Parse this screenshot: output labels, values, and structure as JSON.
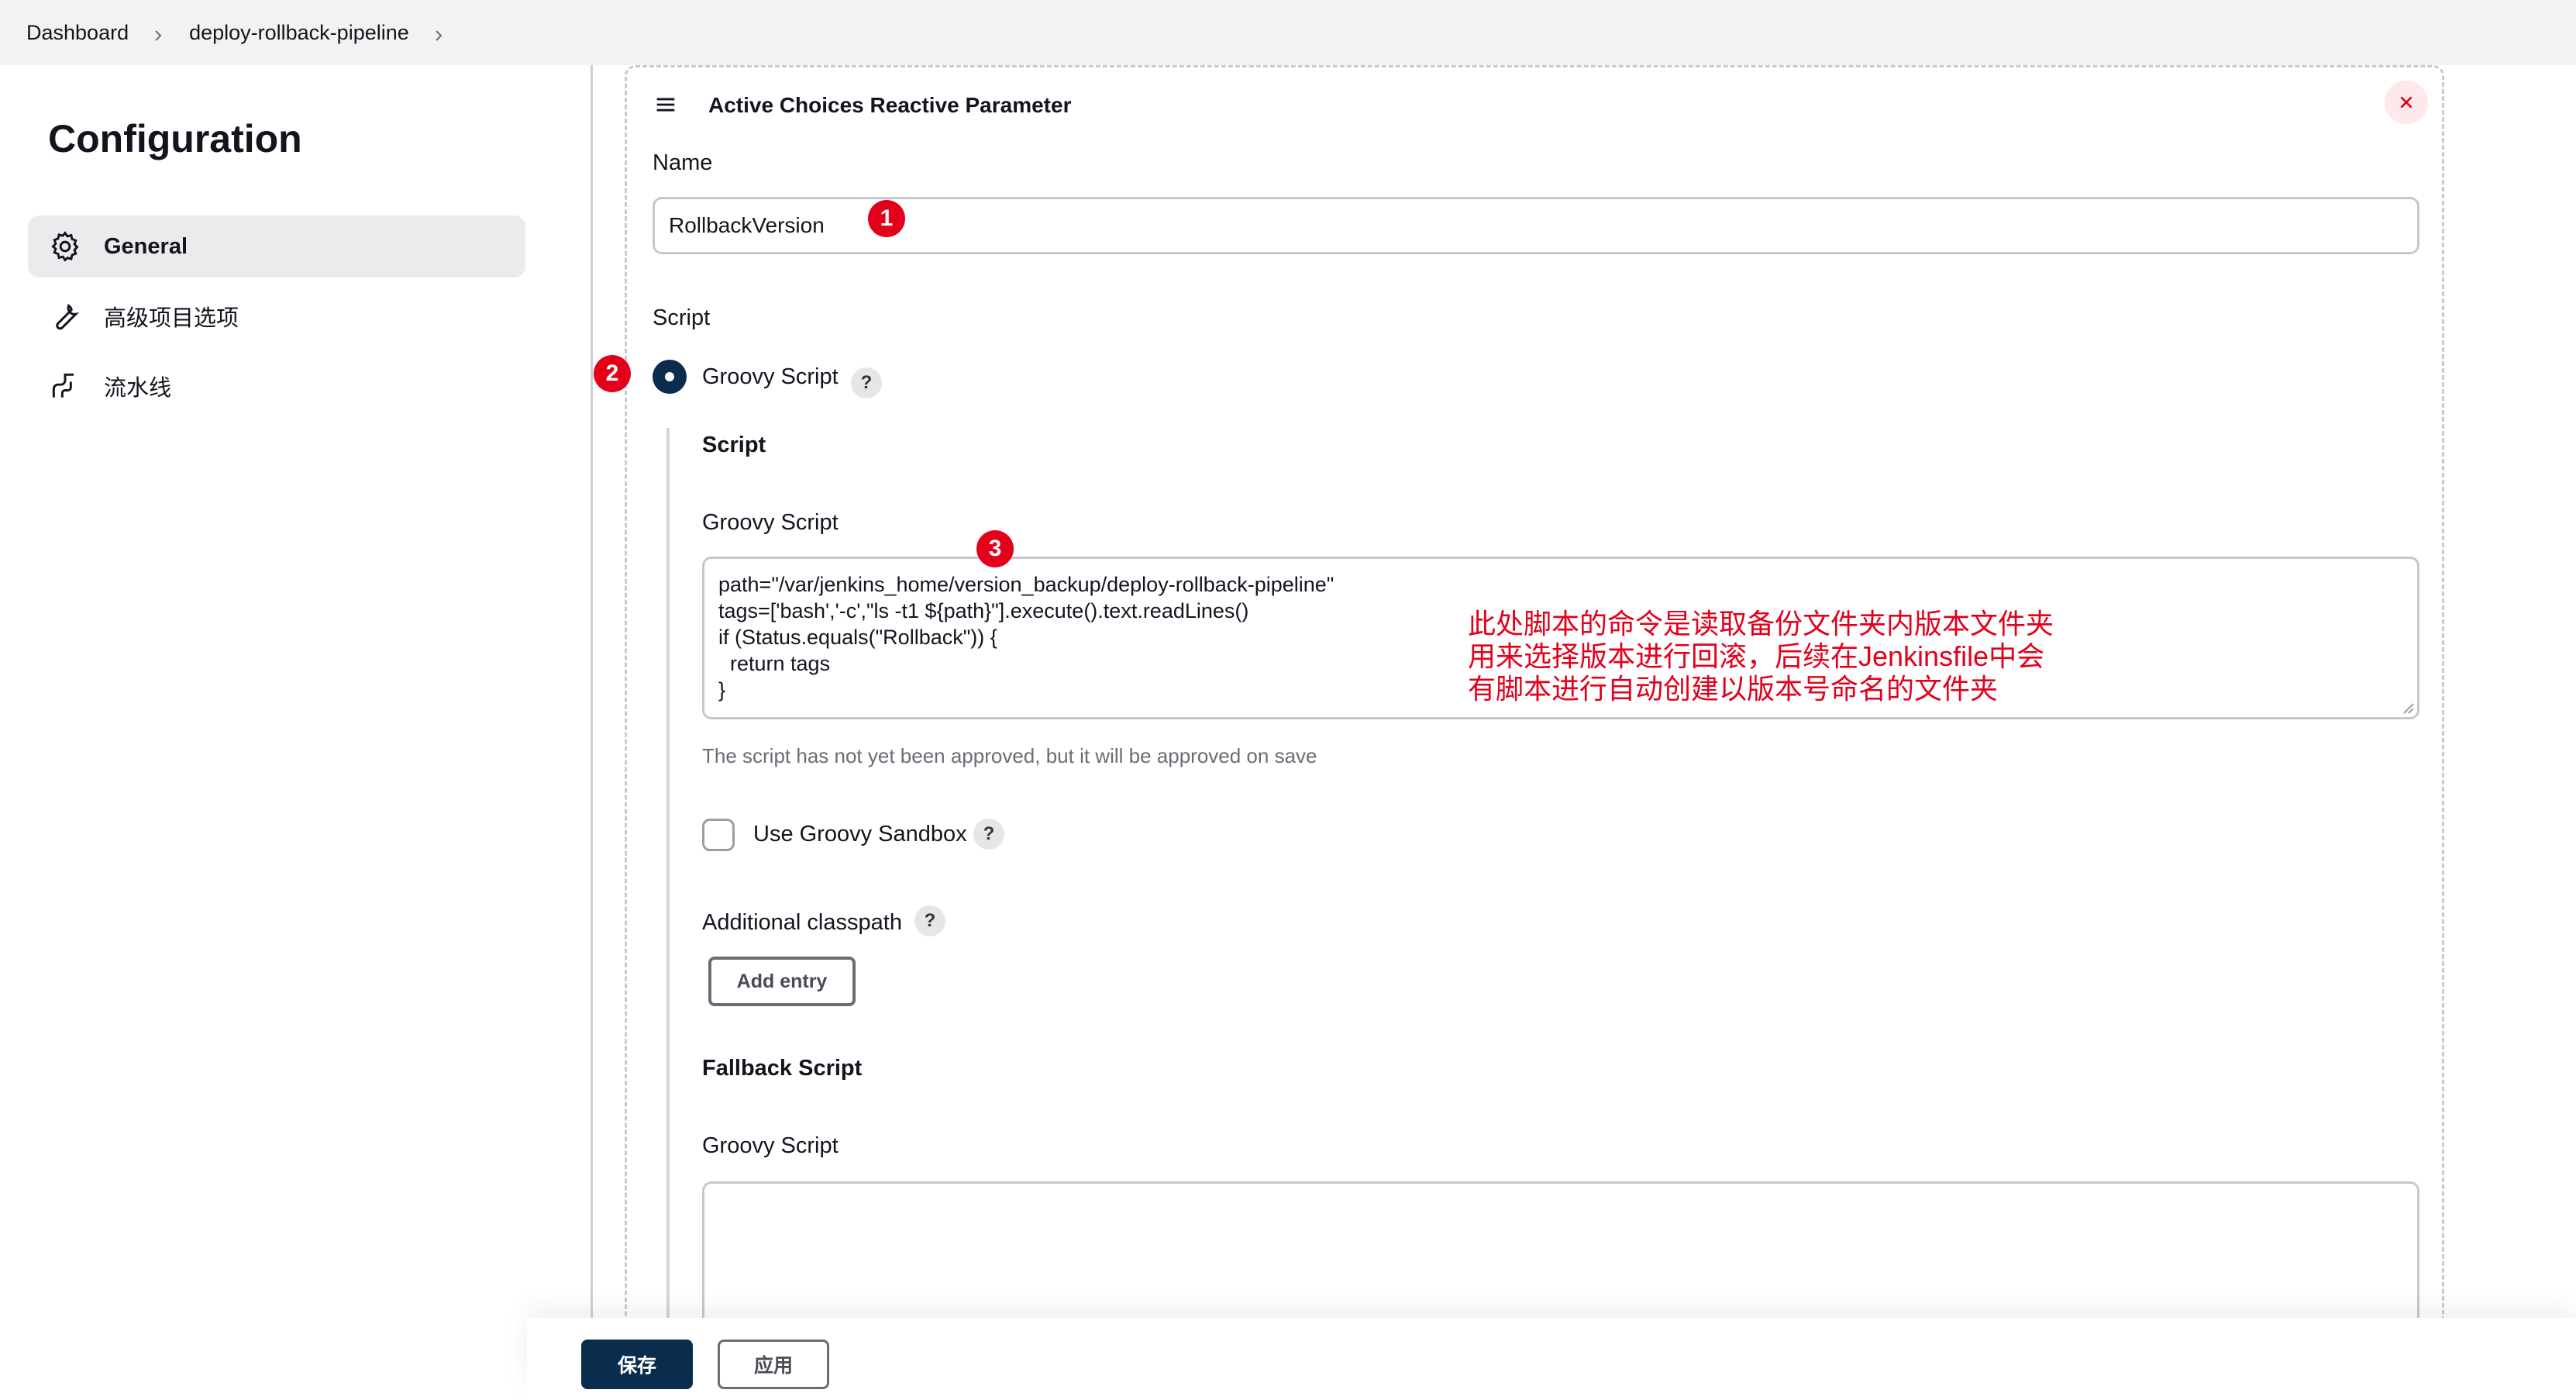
{
  "breadcrumb": {
    "items": [
      {
        "label": "Dashboard"
      },
      {
        "label": "deploy-rollback-pipeline"
      }
    ]
  },
  "sidebar": {
    "title": "Configuration",
    "items": [
      {
        "label": "General",
        "icon": "gear-icon",
        "active": true
      },
      {
        "label": "高级项目选项",
        "icon": "wrench-icon",
        "active": false
      },
      {
        "label": "流水线",
        "icon": "pipeline-icon",
        "active": false
      }
    ]
  },
  "parameter": {
    "type_title": "Active Choices Reactive Parameter",
    "name_label": "Name",
    "name_value": "RollbackVersion",
    "script_label": "Script",
    "groovy_radio_label": "Groovy Script",
    "script_section_title": "Script",
    "groovy_script_label": "Groovy Script",
    "groovy_script_value": "path=\"/var/jenkins_home/version_backup/deploy-rollback-pipeline\"\ntags=['bash','-c',\"ls -t1 ${path}\"].execute().text.readLines()\nif (Status.equals(\"Rollback\")) {\n  return tags\n}",
    "approval_hint": "The script has not yet been approved, but it will be approved on save",
    "sandbox_label": "Use Groovy Sandbox",
    "sandbox_checked": false,
    "classpath_label": "Additional classpath",
    "add_entry_label": "Add entry",
    "fallback_title": "Fallback Script",
    "fallback_groovy_label": "Groovy Script",
    "fallback_value": ""
  },
  "annotations": {
    "markers": [
      "1",
      "2",
      "3"
    ],
    "note": "此处脚本的命令是读取备份文件夹内版本文件夹\n用来选择版本进行回滚，后续在Jenkinsfile中会\n有脚本进行自动创建以版本号命名的文件夹"
  },
  "footer": {
    "save_label": "保存",
    "apply_label": "应用"
  },
  "colors": {
    "primary": "#0a2d4e",
    "annotation_red": "#e3001b",
    "topbar_bg": "#f2f2f3"
  }
}
